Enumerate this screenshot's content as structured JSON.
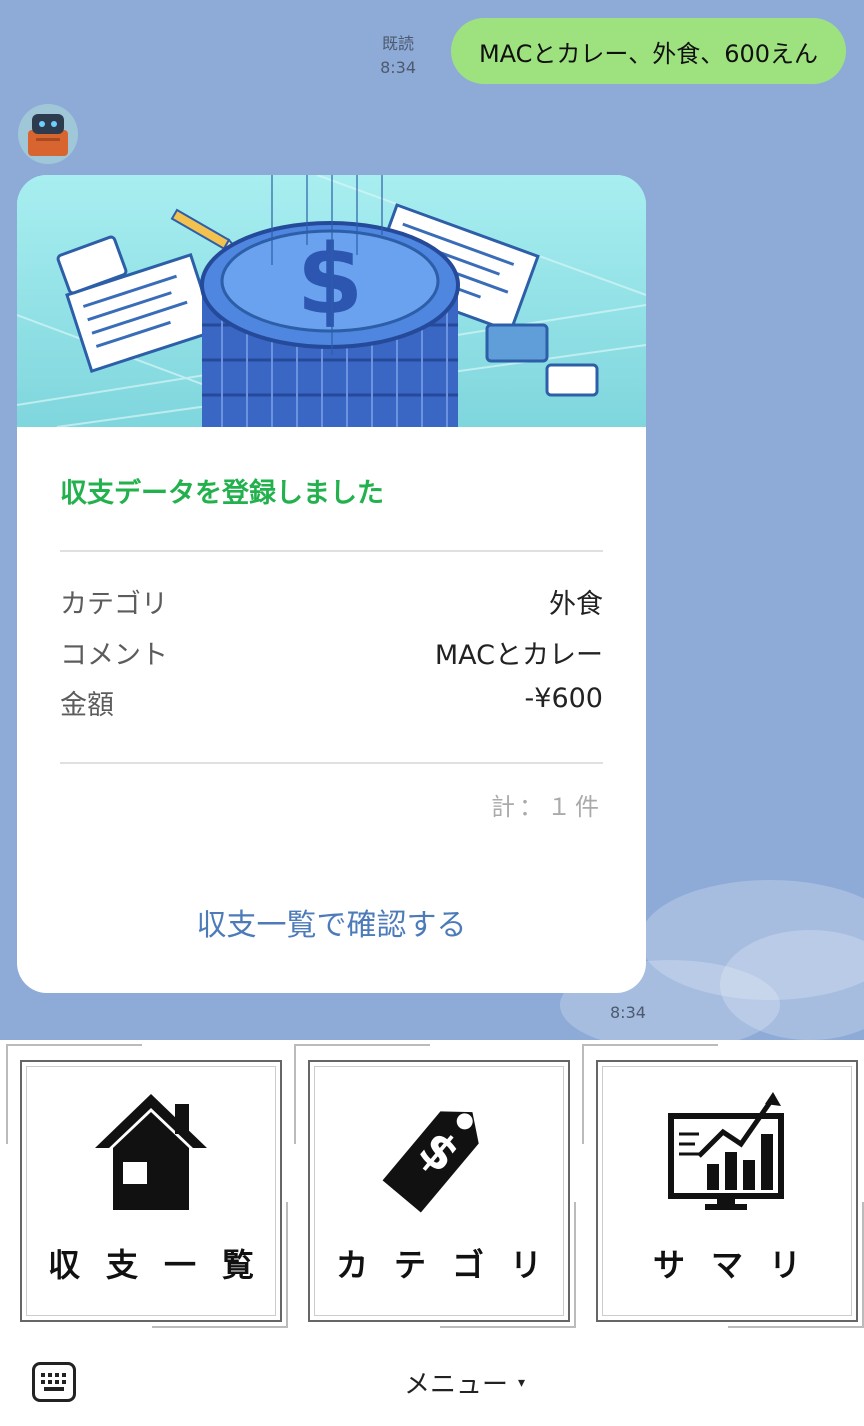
{
  "chat": {
    "user_message": {
      "read_label": "既読",
      "time": "8:34",
      "text": "MACとカレー、外食、600えん"
    },
    "bot_message": {
      "time": "8:34",
      "card": {
        "title": "収支データを登録しました",
        "rows": [
          {
            "key": "カテゴリ",
            "value": "外食"
          },
          {
            "key": "コメント",
            "value": "MACとカレー"
          },
          {
            "key": "金額",
            "value": "-¥600"
          }
        ],
        "count": "計：１件",
        "link": "収支一覧で確認する",
        "colors": {
          "title": "#22b14c",
          "link": "#4d7bba"
        }
      }
    }
  },
  "rich_menu": {
    "tiles": [
      {
        "label": "収支一覧",
        "icon": "house-icon"
      },
      {
        "label": "カテゴリ",
        "icon": "price-tag-icon"
      },
      {
        "label": "サマリ",
        "icon": "chart-monitor-icon"
      }
    ]
  },
  "bottom_bar": {
    "keyboard_icon": "keyboard-icon",
    "menu_label": "メニュー",
    "menu_arrow": "▾"
  },
  "colors": {
    "chat_background": "#8eabd8",
    "user_bubble": "#9ee27f"
  }
}
